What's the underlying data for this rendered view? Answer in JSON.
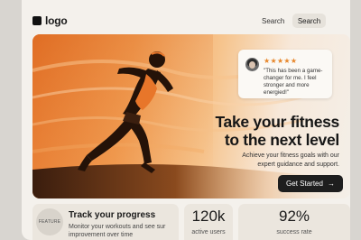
{
  "nav": {
    "logo_text": "logo",
    "search_link": "Search",
    "search_button": "Search"
  },
  "hero": {
    "testimonial": {
      "stars": "★★★★★",
      "rating": 5,
      "quote": "\"This has been a game-changer for me. I feel stronger and more energied!\""
    },
    "title_line1": "Take your fitness",
    "title_line2": "to the next level",
    "subtitle_line1": "Achieve your fitness goals with our",
    "subtitle_line2": "expert guidance and support.",
    "cta_label": "Get Started",
    "cta_arrow": "→"
  },
  "features": {
    "badge": "FEATURE",
    "title": "Track your progress",
    "description": "Monitor your workouts and see sur improvement over time"
  },
  "stats": [
    {
      "value": "120k",
      "label": "active users"
    },
    {
      "value": "92%",
      "label": "success rate"
    }
  ],
  "colors": {
    "accent": "#e7862a",
    "dark": "#1e1e1e",
    "background": "#f4f1ec"
  },
  "icons": {
    "logo": "logo-mark-icon",
    "cta": "arrow-right-icon",
    "rating": "star-icon"
  }
}
